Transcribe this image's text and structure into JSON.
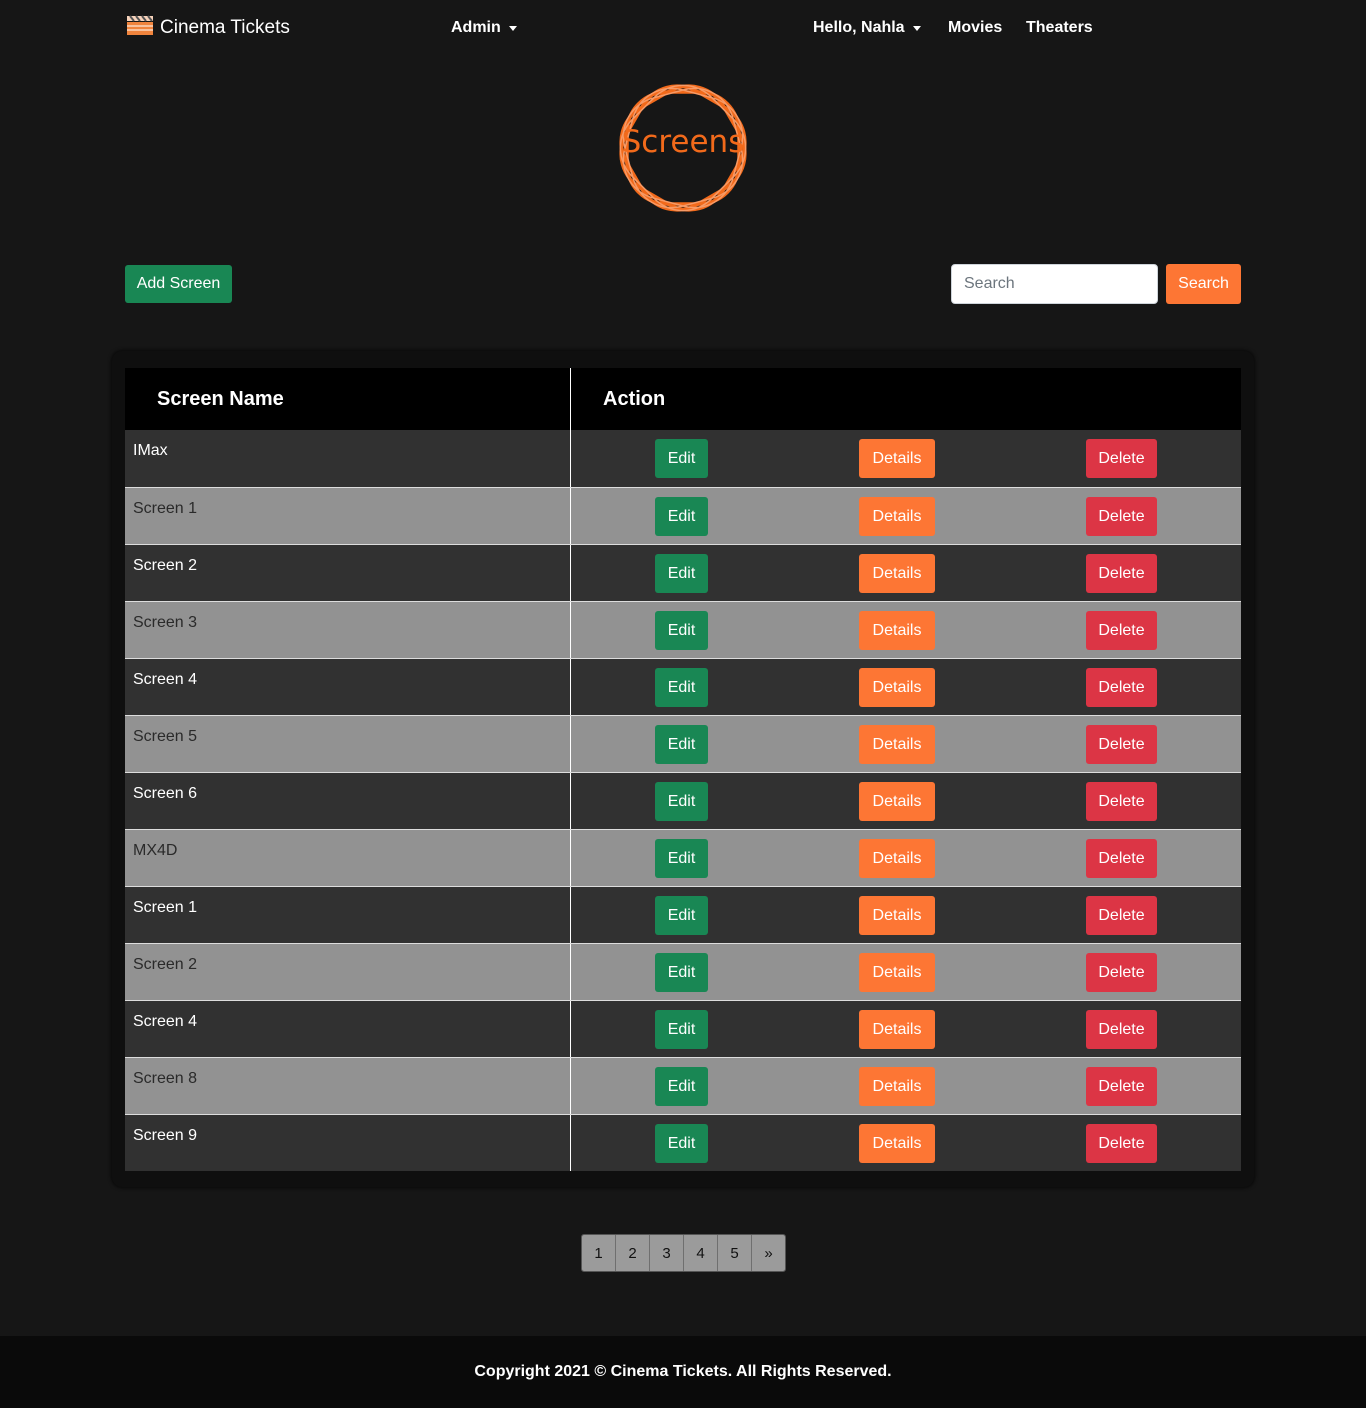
{
  "navbar": {
    "brand": "Cinema Tickets",
    "admin_label": "Admin",
    "user_label": "Hello, Nahla",
    "movies_label": "Movies",
    "theaters_label": "Theaters"
  },
  "logo": {
    "text": "Screens"
  },
  "toolbar": {
    "add_label": "Add Screen",
    "search_placeholder": "Search",
    "search_label": "Search"
  },
  "table": {
    "headers": [
      "Screen Name",
      "Action"
    ],
    "edit_label": "Edit",
    "details_label": "Details",
    "delete_label": "Delete",
    "rows": [
      {
        "name": "IMax"
      },
      {
        "name": "Screen 1"
      },
      {
        "name": "Screen 2"
      },
      {
        "name": "Screen 3"
      },
      {
        "name": "Screen 4"
      },
      {
        "name": "Screen 5"
      },
      {
        "name": "Screen 6"
      },
      {
        "name": "MX4D"
      },
      {
        "name": "Screen 1"
      },
      {
        "name": "Screen 2"
      },
      {
        "name": "Screen 4"
      },
      {
        "name": "Screen 8"
      },
      {
        "name": "Screen 9"
      }
    ]
  },
  "pagination": [
    "1",
    "2",
    "3",
    "4",
    "5",
    "»"
  ],
  "footer": {
    "text": "Copyright 2021 © Cinema Tickets. All Rights Reserved."
  },
  "colors": {
    "accent": "#fd7634",
    "success": "#198754",
    "danger": "#dc3545",
    "background": "#161616"
  }
}
